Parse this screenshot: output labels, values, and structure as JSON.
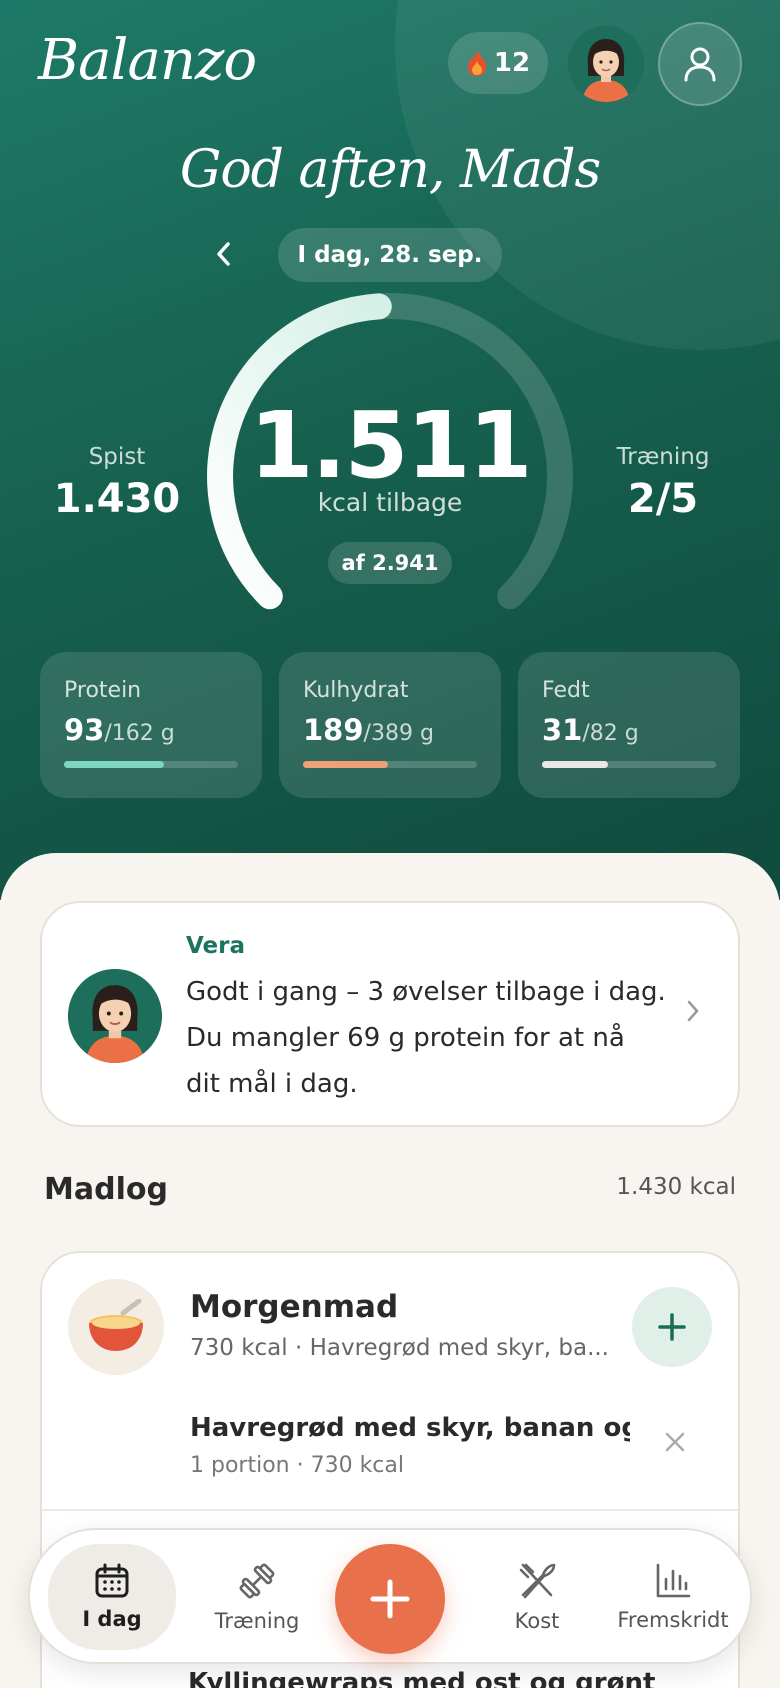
{
  "app": {
    "logo": "Balanzo"
  },
  "header": {
    "streak_count": "12",
    "streak_icon": "flame-icon",
    "profile_icon": "user-icon"
  },
  "greeting": "God aften, Mads",
  "date": {
    "label": "I dag, 28. sep."
  },
  "calories": {
    "remaining": "1.511",
    "remaining_label": "kcal tilbage",
    "goal_label": "af 2.941",
    "eaten_label": "Spist",
    "eaten_value": "1.430",
    "training_label": "Træning",
    "training_value": "2/5",
    "ring_progress": 0.486
  },
  "macros": [
    {
      "label": "Protein",
      "value": "93",
      "goal": "/162 g",
      "progress": 0.574,
      "color": "#7fd6bf"
    },
    {
      "label": "Kulhydrat",
      "value": "189",
      "goal": "/389 g",
      "progress": 0.486,
      "color": "#f0a079"
    },
    {
      "label": "Fedt",
      "value": "31",
      "goal": "/82 g",
      "progress": 0.378,
      "color": "#e8e8e8"
    }
  ],
  "coach": {
    "name": "Vera",
    "message": "Godt i gang – 3 øvelser tilbage i dag. Du mangler 69 g protein for at nå dit mål i dag."
  },
  "foodlog": {
    "title": "Madlog",
    "total": "1.430 kcal",
    "meals": [
      {
        "name": "Morgenmad",
        "summary": "730 kcal · Havregrød med skyr, ba...",
        "icon": "bowl-icon",
        "items": [
          {
            "name": "Havregrød med skyr, banan og h...",
            "detail": "1 portion · 730 kcal"
          }
        ]
      }
    ],
    "next_item_peek": "Kyllingewraps med ost og grønt"
  },
  "tabs": [
    {
      "label": "I dag",
      "icon": "calendar-icon",
      "active": true
    },
    {
      "label": "Træning",
      "icon": "dumbbell-icon",
      "active": false
    },
    {
      "label": "Kost",
      "icon": "utensils-icon",
      "active": false
    },
    {
      "label": "Fremskridt",
      "icon": "bar-chart-icon",
      "active": false
    }
  ],
  "colors": {
    "brand": "#1a6b58",
    "accent": "#e8704a"
  }
}
